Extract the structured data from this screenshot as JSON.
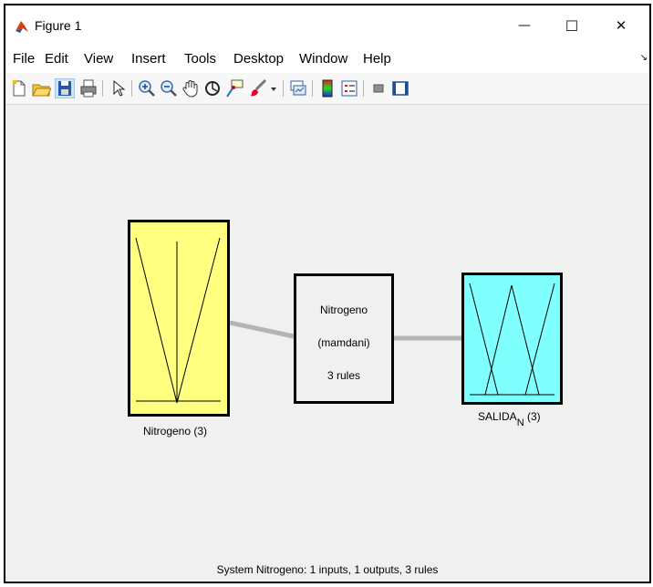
{
  "window": {
    "title": "Figure 1",
    "controls": {
      "minimize": "—",
      "maximize": "☐",
      "close": "✕"
    }
  },
  "menu": {
    "items": [
      {
        "label": "File"
      },
      {
        "label": "Edit"
      },
      {
        "label": "View"
      },
      {
        "label": "Insert"
      },
      {
        "label": "Tools"
      },
      {
        "label": "Desktop"
      },
      {
        "label": "Window"
      },
      {
        "label": "Help"
      }
    ],
    "overflow_icon": "↘"
  },
  "toolbar": {
    "icons": [
      "new-figure-icon",
      "open-file-icon",
      "save-icon",
      "print-icon",
      "pointer-icon",
      "zoom-in-icon",
      "zoom-out-icon",
      "pan-icon",
      "rotate-3d-icon",
      "data-cursor-icon",
      "brush-icon",
      "brush-dropdown-icon",
      "link-plot-icon",
      "insert-colorbar-icon",
      "insert-legend-icon",
      "hide-plot-tools-icon",
      "show-plot-tools-icon"
    ]
  },
  "diagram": {
    "input": {
      "label": "Nitrogeno (3)",
      "color": "#ffff80"
    },
    "system": {
      "name": "Nitrogeno",
      "type": "(mamdani)",
      "rules": "3 rules"
    },
    "output": {
      "label_main": "SALIDA",
      "label_sub": "N",
      "label_tail": " (3)",
      "color": "#80ffff"
    },
    "connector_color": "#b4b4b4"
  },
  "status": {
    "text": "System Nitrogeno: 1 inputs, 1 outputs, 3 rules"
  },
  "colors": {
    "matlab_icon": "#d4400f",
    "window_border": "#000000",
    "canvas": "#f0f0f0"
  }
}
